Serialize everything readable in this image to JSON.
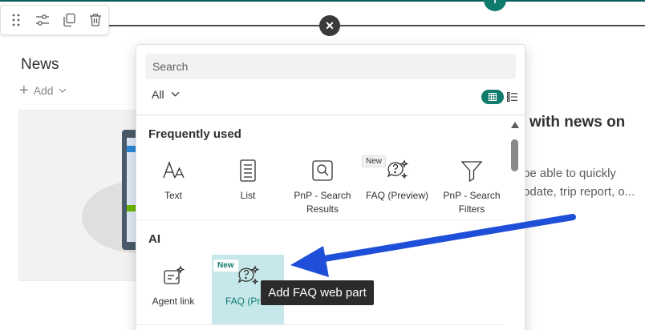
{
  "toolbar": {
    "icons": [
      "drag-handle-icon",
      "edit-properties-icon",
      "duplicate-icon",
      "delete-icon"
    ]
  },
  "news": {
    "title": "News",
    "add_label": "Add"
  },
  "right_panel": {
    "heading": "with news on",
    "line1": "be able to quickly",
    "line2": "odate, trip report, o..."
  },
  "picker": {
    "search_placeholder": "Search",
    "filter_label": "All",
    "groups": [
      {
        "title": "Frequently used",
        "items": [
          {
            "label": "Text",
            "icon": "text-icon"
          },
          {
            "label": "List",
            "icon": "list-icon"
          },
          {
            "label": "PnP - Search Results",
            "icon": "search-results-icon"
          },
          {
            "label": "FAQ (Preview)",
            "icon": "faq-icon",
            "badge": "New"
          },
          {
            "label": "PnP - Search Filters",
            "icon": "filter-icon"
          }
        ]
      },
      {
        "title": "AI",
        "items": [
          {
            "label": "Agent link",
            "icon": "agent-link-icon"
          },
          {
            "label": "FAQ (Prev",
            "icon": "faq-icon",
            "badge": "New",
            "selected": true
          }
        ]
      }
    ]
  },
  "tooltip": "Add FAQ web part",
  "colors": {
    "accent": "#0f7b6c",
    "selected_tile": "#c7e8ea",
    "arrow": "#1f4fd8",
    "tooltip_bg": "#2b2b2b"
  }
}
